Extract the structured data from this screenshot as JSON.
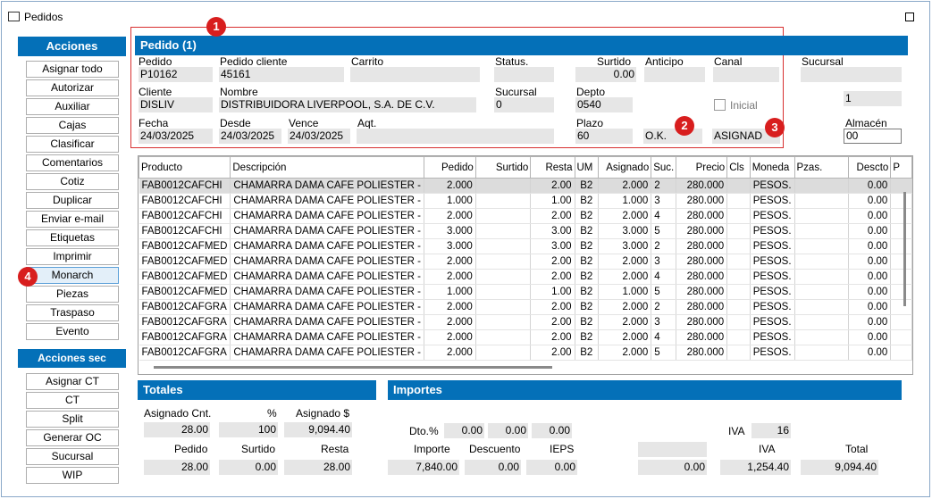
{
  "window": {
    "title": "Pedidos"
  },
  "actions": {
    "title": "Acciones",
    "items": [
      "Asignar todo",
      "Autorizar",
      "Auxiliar",
      "Cajas",
      "Clasificar",
      "Comentarios",
      "Cotiz",
      "Duplicar",
      "Enviar e-mail",
      "Etiquetas",
      "Imprimir",
      "Monarch",
      "Piezas",
      "Traspaso",
      "Evento"
    ],
    "selected": "Monarch"
  },
  "actions_sec": {
    "title": "Acciones sec",
    "items": [
      "Asignar CT",
      "CT",
      "Split",
      "Generar OC",
      "Sucursal",
      "WIP"
    ]
  },
  "badges": [
    "1",
    "2",
    "3",
    "4"
  ],
  "order": {
    "header": "Pedido (1)",
    "pedido_label": "Pedido",
    "pedido": "P10162",
    "pedido_cliente_label": "Pedido cliente",
    "pedido_cliente": "45161",
    "carrito_label": "Carrito",
    "carrito": "",
    "status_label": "Status.",
    "status": "",
    "surtido_label": "Surtido",
    "surtido": "0.00",
    "anticipo_label": "Anticipo",
    "anticipo": "",
    "canal_label": "Canal",
    "canal": "",
    "sucursal_top_label": "Sucursal",
    "sucursal_top": "",
    "cliente_label": "Cliente",
    "cliente": "DISLIV",
    "nombre_label": "Nombre",
    "nombre": "DISTRIBUIDORA LIVERPOOL, S.A. DE C.V.",
    "sucursal_label": "Sucursal",
    "sucursal": "0",
    "depto_label": "Depto",
    "depto": "0540",
    "inicial_label": "Inicial",
    "right_value": "1",
    "fecha_label": "Fecha",
    "fecha": "24/03/2025",
    "desde_label": "Desde",
    "desde": "24/03/2025",
    "vence_label": "Vence",
    "vence": "24/03/2025",
    "aqt_label": "Aqt.",
    "aqt": "",
    "plazo_label": "Plazo",
    "plazo": "60",
    "ok_status": "O.K.",
    "asignado_status": "ASIGNAD",
    "almacen_label": "Almacén",
    "almacen": "00"
  },
  "table": {
    "columns": [
      "Producto",
      "Descripción",
      "Pedido",
      "Surtido",
      "Resta",
      "UM",
      "Asignado",
      "Suc.",
      "Precio",
      "Cls",
      "Moneda",
      "Pzas.",
      "Descto",
      "P"
    ],
    "rows": [
      [
        "FAB0012CAFCHI",
        "CHAMARRA DAMA CAFE POLIESTER  -",
        "2.000",
        "",
        "2.00",
        "B2",
        "2.000",
        "2",
        "280.000",
        "",
        "PESOS.",
        "",
        "0.00"
      ],
      [
        "FAB0012CAFCHI",
        "CHAMARRA DAMA CAFE POLIESTER  -",
        "1.000",
        "",
        "1.00",
        "B2",
        "1.000",
        "3",
        "280.000",
        "",
        "PESOS.",
        "",
        "0.00"
      ],
      [
        "FAB0012CAFCHI",
        "CHAMARRA DAMA CAFE POLIESTER  -",
        "2.000",
        "",
        "2.00",
        "B2",
        "2.000",
        "4",
        "280.000",
        "",
        "PESOS.",
        "",
        "0.00"
      ],
      [
        "FAB0012CAFCHI",
        "CHAMARRA DAMA CAFE POLIESTER  -",
        "3.000",
        "",
        "3.00",
        "B2",
        "3.000",
        "5",
        "280.000",
        "",
        "PESOS.",
        "",
        "0.00"
      ],
      [
        "FAB0012CAFMED",
        "CHAMARRA DAMA CAFE POLIESTER  -",
        "3.000",
        "",
        "3.00",
        "B2",
        "3.000",
        "2",
        "280.000",
        "",
        "PESOS.",
        "",
        "0.00"
      ],
      [
        "FAB0012CAFMED",
        "CHAMARRA DAMA CAFE POLIESTER  -",
        "2.000",
        "",
        "2.00",
        "B2",
        "2.000",
        "3",
        "280.000",
        "",
        "PESOS.",
        "",
        "0.00"
      ],
      [
        "FAB0012CAFMED",
        "CHAMARRA DAMA CAFE POLIESTER  -",
        "2.000",
        "",
        "2.00",
        "B2",
        "2.000",
        "4",
        "280.000",
        "",
        "PESOS.",
        "",
        "0.00"
      ],
      [
        "FAB0012CAFMED",
        "CHAMARRA DAMA CAFE POLIESTER  -",
        "1.000",
        "",
        "1.00",
        "B2",
        "1.000",
        "5",
        "280.000",
        "",
        "PESOS.",
        "",
        "0.00"
      ],
      [
        "FAB0012CAFGRA",
        "CHAMARRA DAMA CAFE POLIESTER  -",
        "2.000",
        "",
        "2.00",
        "B2",
        "2.000",
        "2",
        "280.000",
        "",
        "PESOS.",
        "",
        "0.00"
      ],
      [
        "FAB0012CAFGRA",
        "CHAMARRA DAMA CAFE POLIESTER  -",
        "2.000",
        "",
        "2.00",
        "B2",
        "2.000",
        "3",
        "280.000",
        "",
        "PESOS.",
        "",
        "0.00"
      ],
      [
        "FAB0012CAFGRA",
        "CHAMARRA DAMA CAFE POLIESTER  -",
        "2.000",
        "",
        "2.00",
        "B2",
        "2.000",
        "4",
        "280.000",
        "",
        "PESOS.",
        "",
        "0.00"
      ],
      [
        "FAB0012CAFGRA",
        "CHAMARRA DAMA CAFE POLIESTER  -",
        "2.000",
        "",
        "2.00",
        "B2",
        "2.000",
        "5",
        "280.000",
        "",
        "PESOS.",
        "",
        "0.00"
      ]
    ]
  },
  "totales": {
    "header": "Totales",
    "asignado_cnt_label": "Asignado Cnt.",
    "asignado_cnt": "28.00",
    "pct_label": "%",
    "pct": "100",
    "asignado_amt_label": "Asignado $",
    "asignado_amt": "9,094.40",
    "pedido_label": "Pedido",
    "pedido": "28.00",
    "surtido_label": "Surtido",
    "surtido": "0.00",
    "resta_label": "Resta",
    "resta": "28.00"
  },
  "importes": {
    "header": "Importes",
    "dto_label": "Dto.%",
    "dto1": "0.00",
    "dto2": "0.00",
    "dto3": "0.00",
    "iva_pct_label": "IVA",
    "iva_pct": "16",
    "importe_label": "Importe",
    "importe": "7,840.00",
    "descuento_label": "Descuento",
    "descuento": "0.00",
    "ieps_label": "IEPS",
    "ieps": "0.00",
    "blank1": "",
    "blank2": "0.00",
    "iva_label": "IVA",
    "iva": "1,254.40",
    "total_label": "Total",
    "total": "9,094.40"
  }
}
